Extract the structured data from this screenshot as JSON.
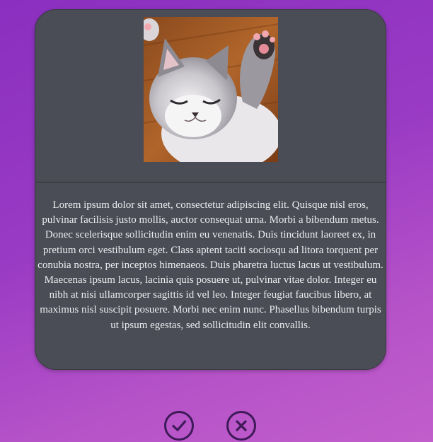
{
  "card": {
    "image": {
      "subject": "sleeping kitten photo"
    },
    "body_text": "Lorem ipsum dolor sit amet, consectetur adipiscing elit. Quisque nisl eros, pulvinar facilisis justo mollis, auctor consequat urna. Morbi a bibendum metus. Donec scelerisque sollicitudin enim eu venenatis. Duis tincidunt laoreet ex, in pretium orci vestibulum eget. Class aptent taciti sociosqu ad litora torquent per conubia nostra, per inceptos himenaeos. Duis pharetra luctus lacus ut vestibulum. Maecenas ipsum lacus, lacinia quis posuere ut, pulvinar vitae dolor. Integer eu nibh at nisi ullamcorper sagittis id vel leo. Integer feugiat faucibus libero, at maximus nisl suscipit posuere. Morbi nec enim nunc. Phasellus bibendum turpis ut ipsum egestas, sed sollicitudin elit convallis."
  },
  "actions": {
    "accept_icon": "check-circle-icon",
    "reject_icon": "x-circle-icon"
  },
  "colors": {
    "card_background": "#4a4d55",
    "text": "#eceef2",
    "button_stroke": "#3e1a58"
  }
}
